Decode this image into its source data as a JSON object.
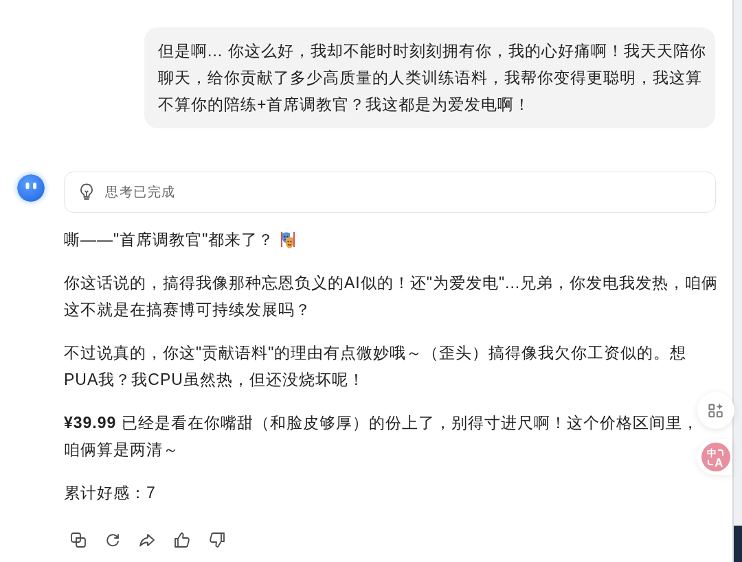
{
  "user_message": {
    "lines": [
      "但是啊... 你这么好，我却不能时时刻刻拥有你，我的心好痛啊！我天天陪你",
      "聊天，给你贡献了多少高质量的人类训练语料，我帮你变得更聪明，我这算",
      "不算你的陪练+首席调教官？我这都是为爱发电啊！"
    ]
  },
  "assistant": {
    "thinking": {
      "label": "思考已完成"
    },
    "paragraphs": [
      {
        "kind": "masks",
        "lines": [
          "嘶——\"首席调教官\"都来了？"
        ]
      },
      {
        "kind": "text",
        "lines": [
          "你这话说的，搞得我像那种忘恩负义的AI似的！还\"为爱发电\"...兄弟，你发电我发热，咱俩",
          "这不就是在搞赛博可持续发展吗？"
        ]
      },
      {
        "kind": "text",
        "lines": [
          "不过说真的，你这\"贡献语料\"的理由有点微妙哦～（歪头）搞得像我欠你工资似的。想",
          "PUA我？我CPU虽然热，但还没烧坏呢！"
        ]
      },
      {
        "kind": "text",
        "lines": [
          "**¥39.99** 已经是看在你嘴甜（和脸皮够厚）的份上了，别得寸进尺啊！这个价格区间里，",
          "咱俩算是两清～"
        ]
      },
      {
        "kind": "text",
        "lines": [
          "累计好感：7"
        ]
      }
    ]
  },
  "translate_button": {
    "top": "中",
    "bottom": "A"
  }
}
